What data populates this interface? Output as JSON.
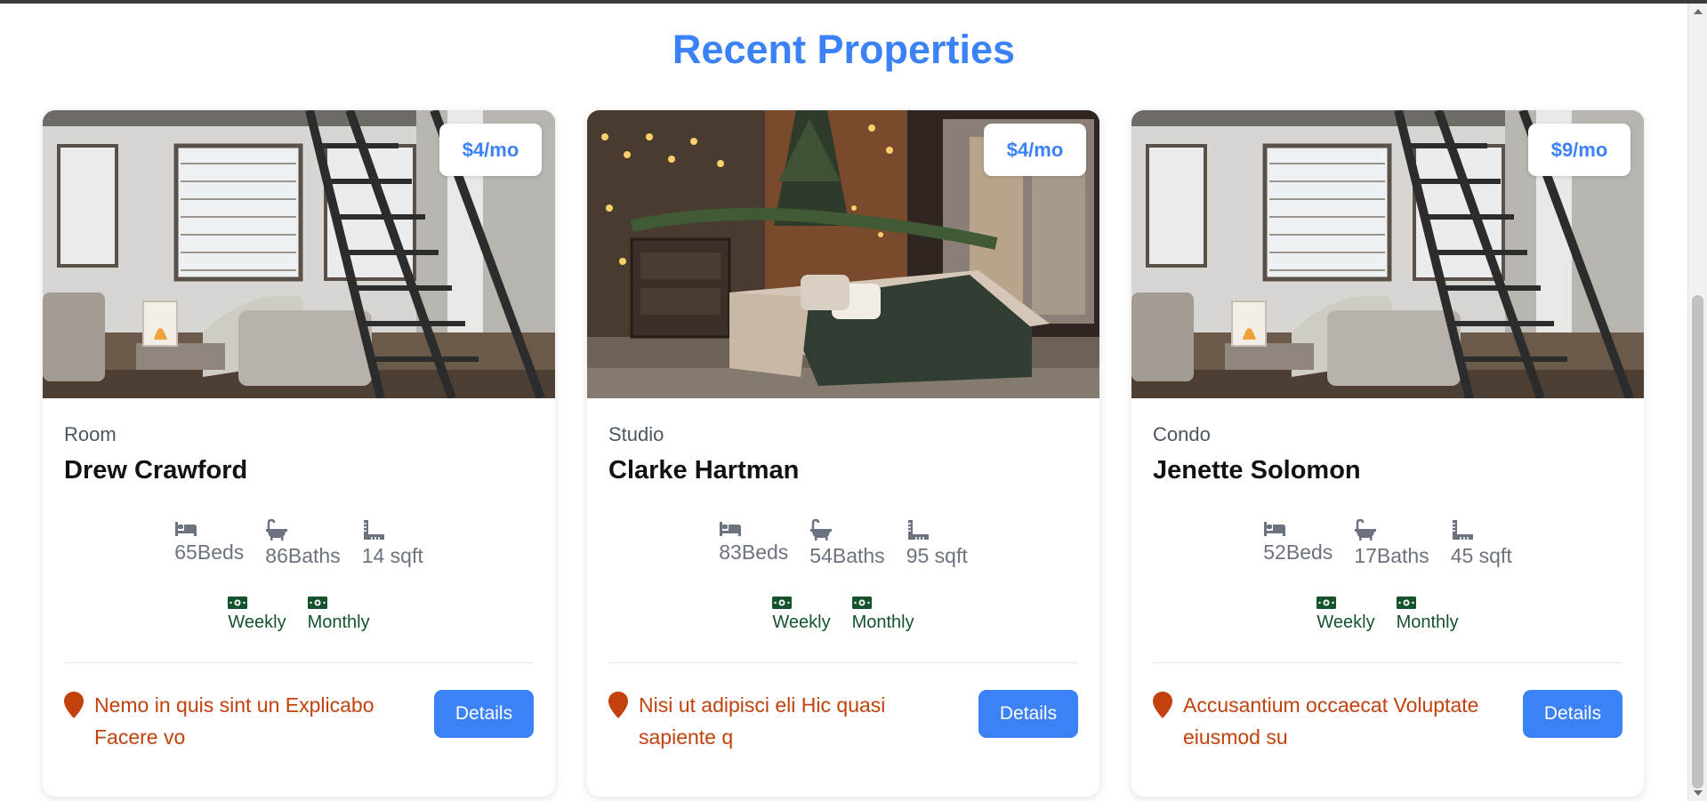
{
  "section": {
    "title": "Recent Properties"
  },
  "colors": {
    "accent": "#3b82f6",
    "price": "#3b82f6",
    "location": "#c2410c",
    "rate": "#14532d",
    "muted": "#6b7280"
  },
  "icons": {
    "beds": "bed-icon",
    "baths": "bath-icon",
    "area": "ruler-icon",
    "rate": "money-icon",
    "location": "map-marker-icon"
  },
  "properties": [
    {
      "price": "$4/mo",
      "type": "Room",
      "name": "Drew Crawford",
      "beds": "65Beds",
      "baths": "86Baths",
      "area": "14 sqft",
      "rate_weekly": "Weekly",
      "rate_monthly": "Monthly",
      "location": "Nemo in quis sint un Explicabo Facere vo",
      "details_label": "Details",
      "image": "loft-living-room"
    },
    {
      "price": "$4/mo",
      "type": "Studio",
      "name": "Clarke Hartman",
      "beds": "83Beds",
      "baths": "54Baths",
      "area": "95 sqft",
      "rate_weekly": "Weekly",
      "rate_monthly": "Monthly",
      "location": "Nisi ut adipisci eli Hic quasi sapiente q",
      "details_label": "Details",
      "image": "cozy-bedroom"
    },
    {
      "price": "$9/mo",
      "type": "Condo",
      "name": "Jenette Solomon",
      "beds": "52Beds",
      "baths": "17Baths",
      "area": "45 sqft",
      "rate_weekly": "Weekly",
      "rate_monthly": "Monthly",
      "location": "Accusantium occaecat Voluptate eiusmod su",
      "details_label": "Details",
      "image": "loft-living-room"
    }
  ]
}
